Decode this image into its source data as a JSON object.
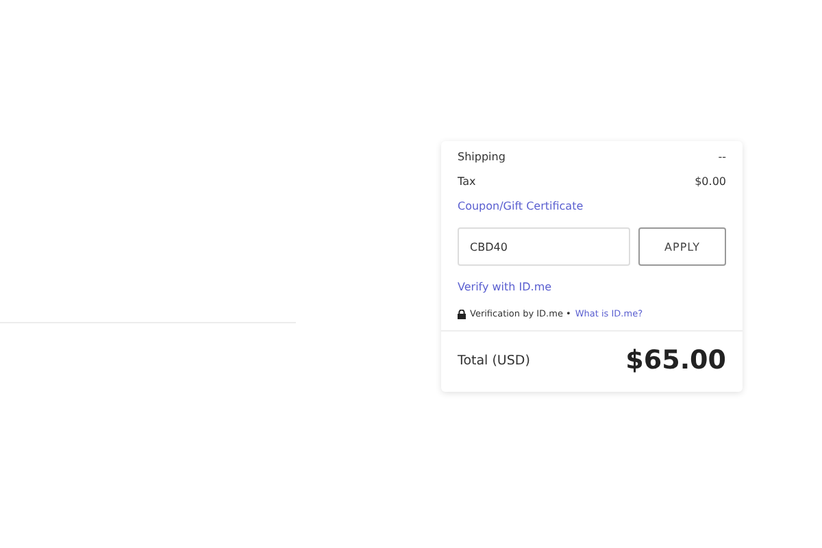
{
  "summary": {
    "rows": [
      {
        "label": "Shipping",
        "value": "--"
      },
      {
        "label": "Tax",
        "value": "$0.00"
      }
    ],
    "coupon": {
      "label": "Coupon/Gift Certificate",
      "value": "CBD40",
      "button": "APPLY"
    },
    "verify": {
      "link": "Verify with ID.me",
      "note": "Verification by ID.me •",
      "note_link": "What is ID.me?"
    },
    "total": {
      "label": "Total (USD)",
      "value": "$65.00"
    }
  }
}
